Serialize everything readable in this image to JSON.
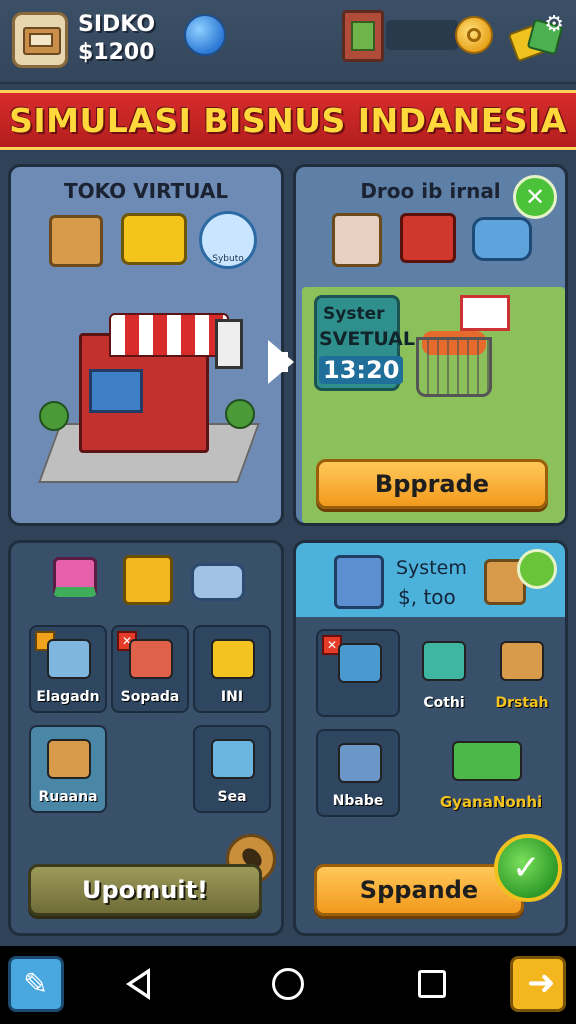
{
  "header": {
    "user_name": "SIDKO",
    "user_money": "$1200"
  },
  "banner": {
    "title": "SIMULASI BISNUS INDANESIA"
  },
  "toko_panel": {
    "title": "TOKO VIRTUAL",
    "badge_text": "Sybuto"
  },
  "system_panel": {
    "title": "Droo ib irnal",
    "timer_label1": "Syster",
    "timer_label2": "SVETUAL",
    "timer_value": "13:20",
    "button_label": "Bpprade"
  },
  "items_panel": {
    "items": [
      {
        "label": "Elagadn"
      },
      {
        "label": "Sopada"
      },
      {
        "label": "INI"
      },
      {
        "label": "Ruaana"
      },
      {
        "label": "Sea"
      }
    ],
    "button_label": "Upomuit!"
  },
  "system2_panel": {
    "title": "System",
    "money": "$, too",
    "items": [
      {
        "label": "Cothi"
      },
      {
        "label": "Drstah"
      },
      {
        "label": "Nbabe"
      },
      {
        "label": "GyanaNonhi"
      }
    ],
    "button_label": "Sppande"
  }
}
